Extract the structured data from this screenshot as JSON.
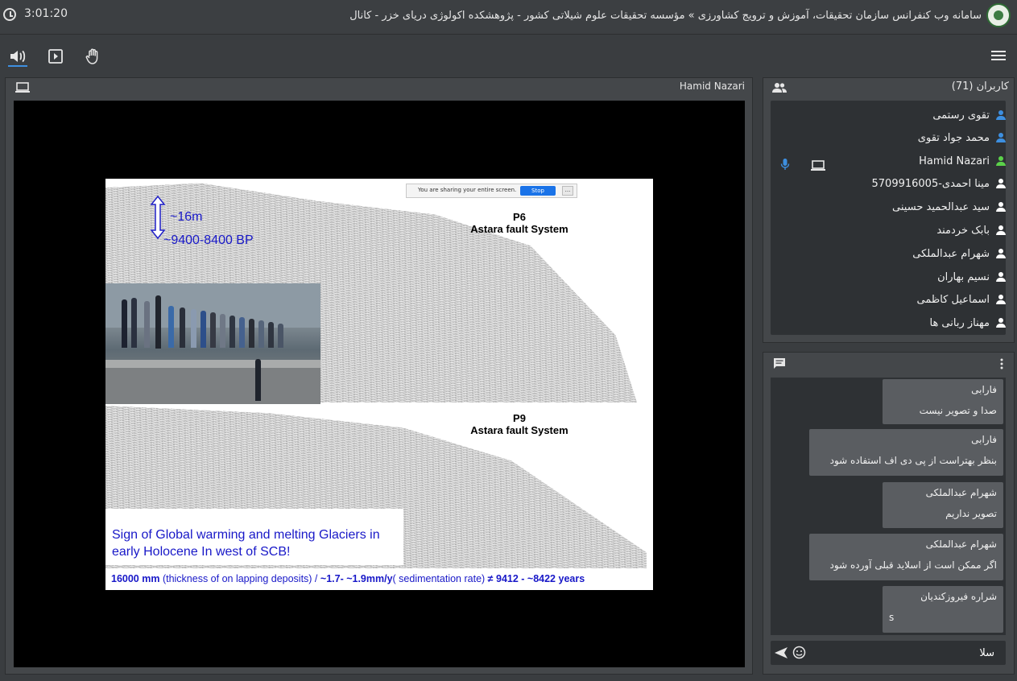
{
  "header": {
    "clock": "3:01:20",
    "title": "سامانه وب کنفرانس سازمان تحقیقات، آموزش و ترویج کشاورزی » مؤسسه تحقیقات علوم شیلاتی کشور - پژوهشکده اکولوژی دریای خزر - کانال"
  },
  "share": {
    "presenter": "Hamid Nazari",
    "slide": {
      "scale_bar": "~16m",
      "age": "~9400-8400 BP",
      "sharing_text": "You are sharing your entire screen.",
      "stop_sharing": "Stop Sharing",
      "hide_label": "...",
      "p6_code": "P6",
      "p6_name": "Astara fault System",
      "p9_code": "P9",
      "p9_name": "Astara fault System",
      "headline_line1": "Sign of Global warming and melting Glaciers in",
      "headline_line2": "early Holocene In west of SCB!",
      "footer_a": "16000 mm",
      "footer_b": " (thickness of on lapping deposits) / ",
      "footer_c": "~1.7- ~1.9mm/y",
      "footer_d": "( sedimentation rate) ",
      "footer_e": "≠ 9412 - ~8422 years"
    }
  },
  "users": {
    "header": "کاربران (71)",
    "list": [
      {
        "name": "تقوی رستمی",
        "color": "#3d8fe0"
      },
      {
        "name": "محمد جواد تقوی",
        "color": "#3d8fe0"
      },
      {
        "name": "Hamid Nazari",
        "color": "#5bd14a"
      },
      {
        "name": "مینا احمدی-5709916005",
        "color": "#ffffff"
      },
      {
        "name": "سید عبدالحمید حسینی",
        "color": "#ffffff"
      },
      {
        "name": "بابک خردمند",
        "color": "#ffffff"
      },
      {
        "name": "شهرام عبدالملکی",
        "color": "#ffffff"
      },
      {
        "name": "نسیم بهاران",
        "color": "#ffffff"
      },
      {
        "name": "اسماعیل کاظمی",
        "color": "#ffffff"
      },
      {
        "name": "مهناز ربانی ها",
        "color": "#ffffff"
      }
    ]
  },
  "chat": {
    "messages": [
      {
        "author": "فارابی",
        "text": "صدا و تصویر نیست"
      },
      {
        "author": "فارابی",
        "text": "بنظر بهتراست از پی دی اف استفاده شود"
      },
      {
        "author": "شهرام عبدالملکی",
        "text": "تصویر نداریم"
      },
      {
        "author": "شهرام عبدالملکی",
        "text": "اگر ممکن است از اسلاید قبلی آورده شود"
      },
      {
        "author": "شراره فیروزکندیان",
        "text": "s"
      }
    ],
    "input_value": "سلا"
  },
  "colors": {
    "accent": "#3d8fe0",
    "mic_active": "#3d8fe0",
    "presenter_user": "#5bd14a"
  }
}
